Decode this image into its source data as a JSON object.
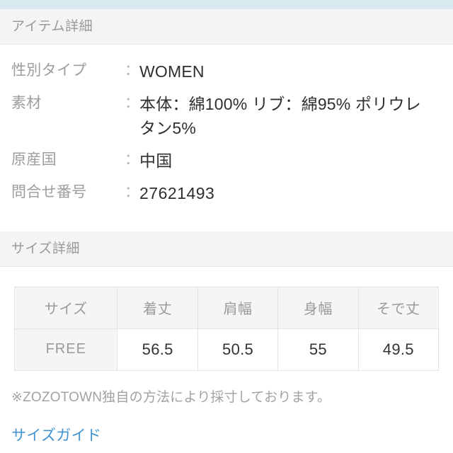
{
  "theme": {
    "top_strip_color": "#d8e9ef",
    "section_header_bg": "#f4f4f4",
    "label_color": "#9e9e9e",
    "value_color": "#2f2f2f",
    "link_color": "#4294d0",
    "table_header_bg": "#f5f5f5",
    "table_border_color": "#e4e4e4"
  },
  "item_detail": {
    "section_title": "アイテム詳細",
    "rows": [
      {
        "label": "性別タイプ",
        "separator": "：",
        "value": "WOMEN"
      },
      {
        "label": "素材",
        "separator": "：",
        "value": "本体：綿100% リブ：綿95% ポリウレタン5%"
      },
      {
        "label": "原産国",
        "separator": "：",
        "value": "中国"
      },
      {
        "label": "問合せ番号",
        "separator": "：",
        "value": "27621493"
      }
    ]
  },
  "size_detail": {
    "section_title": "サイズ詳細",
    "table": {
      "headers": [
        "サイズ",
        "着丈",
        "肩幅",
        "身幅",
        "そで丈"
      ],
      "rows": [
        {
          "size": "FREE",
          "values": [
            "56.5",
            "50.5",
            "55",
            "49.5"
          ]
        }
      ]
    },
    "note": "※ZOZOTOWN独自の方法により採寸しております。",
    "size_guide_link": "サイズガイド"
  }
}
